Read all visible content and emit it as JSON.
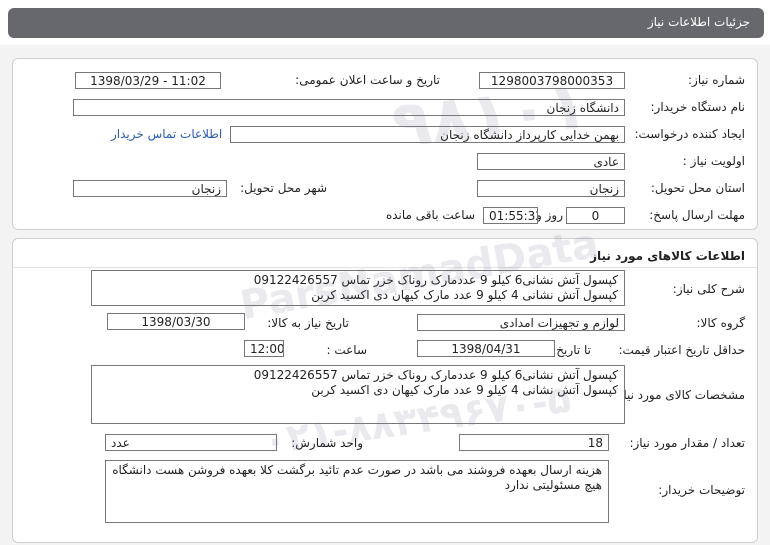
{
  "header": {
    "title": "جزئیات اطلاعات نیاز"
  },
  "need_info": {
    "need_number_label": "شماره نیاز:",
    "need_number": "1298003798000353",
    "announce_label": "تاریخ و ساعت اعلان عمومی:",
    "announce_value": "1398/03/29 - 11:02",
    "buyer_org_label": "نام دستگاه خریدار:",
    "buyer_org": "دانشگاه زنجان",
    "requester_label": "ایجاد کننده درخواست:",
    "requester": "بهمن خدایی کارپرداز دانشگاه زنجان",
    "contact_link": "اطلاعات تماس خریدار",
    "priority_label": "اولویت نیاز :",
    "priority": "عادی",
    "province_label": "استان محل تحویل:",
    "province": "زنجان",
    "city_label": "شهر محل تحویل:",
    "city": "زنجان",
    "deadline_label": "مهلت ارسال پاسخ:",
    "days": "0",
    "days_label": "روز و",
    "time": "01:55:32",
    "remaining_label": "ساعت باقی مانده"
  },
  "goods": {
    "section_title": "اطلاعات کالاهای مورد نیاز",
    "summary_label": "شرح کلی نیاز:",
    "summary_lines": [
      "کپسول آتش نشانی6 کیلو 9 عددمارک روناک خزر تماس 09122426557",
      "کپسول آتش نشانی 4 کیلو 9 عدد مارک کیهان دی اکسید کربن"
    ],
    "group_label": "گروه کالا:",
    "group": "لوازم و تجهیزات امدادی",
    "need_date_label": "تاریخ نیاز به کالا:",
    "need_date": "1398/03/30",
    "min_price_label": "حداقل تاریخ اعتبار قیمت:",
    "until_date_label": "تا تاریخ :",
    "until_date": "1398/04/31",
    "time_label": "ساعت :",
    "time": "12:00",
    "spec_label": "مشخصات کالای مورد نیاز:",
    "spec_lines": [
      "کپسول آتش نشانی6 کیلو 9 عددمارک روناک خزر تماس 09122426557",
      "کپسول آتش نشانی 4 کیلو 9 عدد مارک کیهان دی اکسید کربن"
    ],
    "qty_label": "تعداد / مقدار مورد نیاز:",
    "qty": "18",
    "unit_label": "واحد شمارش:",
    "unit": "عدد",
    "buyer_notes_label": "توضیحات خریدار:",
    "buyer_notes_lines": [
      "هزینه ارسال بعهده فروشند می باشد در صورت عدم تائید برگشت کلا بعهده فروشن هست دانشگاه",
      "هیچ مسئولیتی ندارد"
    ]
  },
  "watermark": {
    "brand": "ParsNamadData",
    "phone": "۰۲۱-۸۸۳۴۹۶۷۰-۵",
    "big_number": "۹۸۱۰۱"
  }
}
